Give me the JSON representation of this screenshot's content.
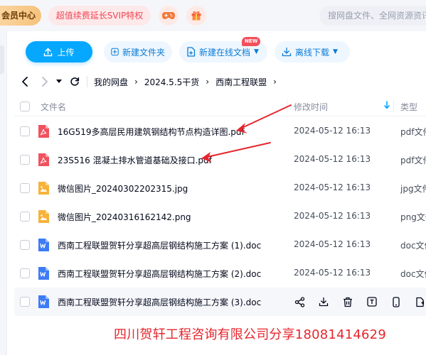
{
  "topbar": {
    "member_label": "会员中心",
    "svip_label": "超值续费延长SVIP特权",
    "game_icon": "gamepad-icon",
    "gift_icon": "gift-icon",
    "search_placeholder": "搜网盘文件、全网资源资讯"
  },
  "toolbar": {
    "upload_label": "上传",
    "new_folder_label": "新建文件夹",
    "new_online_doc_label": "新建在线文档",
    "new_badge": "NEW",
    "offline_download_label": "离线下载"
  },
  "breadcrumb": {
    "items": [
      "我的网盘",
      "2024.5.5干货",
      "西南工程联盟"
    ]
  },
  "table": {
    "headers": {
      "name": "文件名",
      "modified": "修改时间",
      "type": "类型"
    },
    "rows": [
      {
        "name": "16G519多高层民用建筑钢结构节点构造详图.pdf",
        "modified": "2024-05-12 16:13",
        "type": "pdf文件",
        "icon": "pdf-icon"
      },
      {
        "name": "23S516 混凝土排水管道基础及接口.pdf",
        "modified": "2024-05-12 16:13",
        "type": "pdf文件",
        "icon": "pdf-icon"
      },
      {
        "name": "微信图片_20240302202315.jpg",
        "modified": "2024-05-12 16:13",
        "type": "jpg文件",
        "icon": "image-icon"
      },
      {
        "name": "微信图片_20240316162142.png",
        "modified": "2024-05-12 16:13",
        "type": "png文件",
        "icon": "image-icon"
      },
      {
        "name": "西南工程联盟贺轩分享超高层钢结构施工方案 (1).doc",
        "modified": "2024-05-12 16:13",
        "type": "doc文件",
        "icon": "word-icon"
      },
      {
        "name": "西南工程联盟贺轩分享超高层钢结构施工方案 (2).doc",
        "modified": "2024-05-12 16:13",
        "type": "doc文件",
        "icon": "word-icon"
      },
      {
        "name": "西南工程联盟贺轩分享超高层钢结构施工方案 (3).doc",
        "icon": "word-icon"
      }
    ]
  },
  "watermark": "四川贺轩工程咨询有限公司分享18081414629",
  "colors": {
    "accent": "#06a7ff",
    "pdf": "#f0525f",
    "image": "#f7b23b",
    "word": "#3d7bf5",
    "annotation_red": "#e5262d"
  }
}
